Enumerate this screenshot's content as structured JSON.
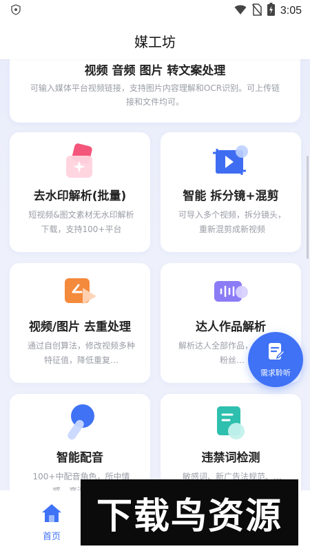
{
  "status_bar": {
    "time": "3:05",
    "icons": [
      "shield-icon",
      "wifi-icon",
      "no-sim-icon",
      "battery-charging-icon"
    ]
  },
  "header": {
    "title": "媒工坊"
  },
  "banner": {
    "title": "视频 音频 图片 转文案处理",
    "description": "可输入媒体平台视频链接，支持图片内容理解和OCR识别。可上传链接和文件均可。"
  },
  "features": [
    {
      "title": "去水印解析(批量)",
      "description": "短视频&图文素材无水印解析下载，支持100+平台",
      "icon": "watermark-removal-icon"
    },
    {
      "title": "智能 拆分镜+混剪",
      "description": "可导入多个视频，拆分镜头，重新混剪成新视频",
      "icon": "video-split-icon"
    },
    {
      "title": "视频/图片 去重处理",
      "description": "通过自创算法，修改视频多种特征值，降低重复…",
      "icon": "dedup-icon"
    },
    {
      "title": "达人作品解析",
      "description": "解析达人全部作品，查看达人粉丝…",
      "icon": "audio-wave-icon"
    },
    {
      "title": "智能配音",
      "description": "100+中配音角色，所中情感，高清发音…",
      "icon": "brush-icon"
    },
    {
      "title": "违禁词检测",
      "description": "敏感词、新广告法规范、…",
      "icon": "document-check-icon"
    }
  ],
  "fab": {
    "label": "需求聆听",
    "icon": "edit-document-icon"
  },
  "tab_bar": {
    "items": [
      {
        "label": "首页",
        "icon": "home-icon",
        "active": true
      }
    ]
  },
  "watermark": {
    "text": "下载鸟资源"
  },
  "colors": {
    "accent": "#3f72f5",
    "background": "#eef1fb",
    "card": "#ffffff",
    "muted_text": "#9a9da6"
  }
}
